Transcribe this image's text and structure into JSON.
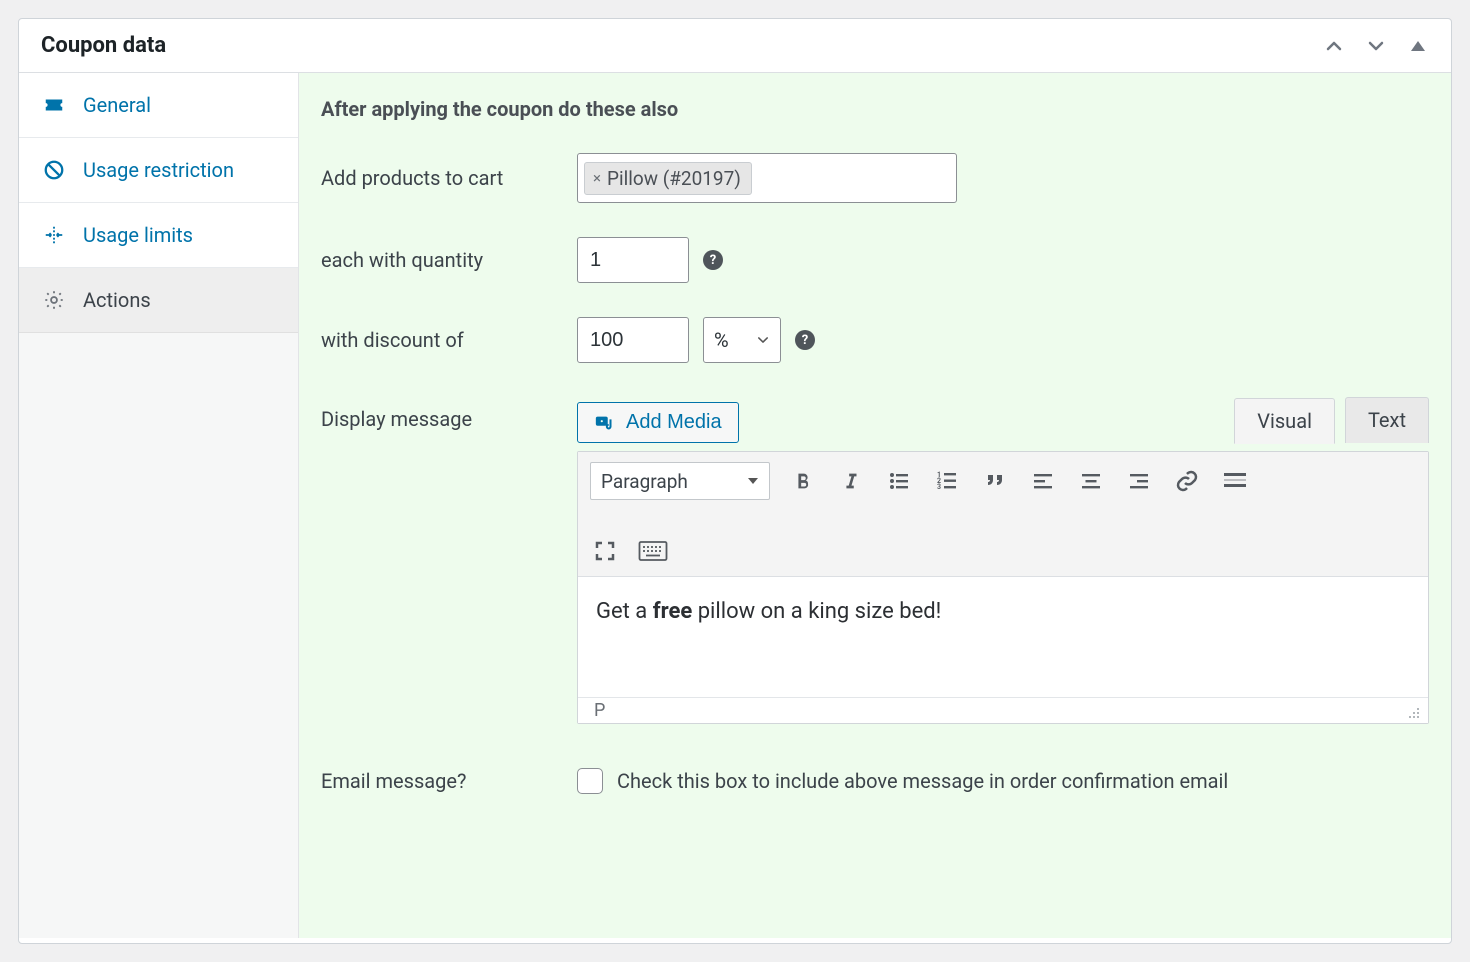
{
  "panel": {
    "title": "Coupon data"
  },
  "sidebar": {
    "items": [
      {
        "id": "general",
        "label": "General"
      },
      {
        "id": "usage-restriction",
        "label": "Usage restriction"
      },
      {
        "id": "usage-limits",
        "label": "Usage limits"
      },
      {
        "id": "actions",
        "label": "Actions"
      }
    ],
    "active": "actions"
  },
  "content": {
    "heading": "After applying the coupon do these also",
    "add_products_label": "Add products to cart",
    "products": [
      {
        "label": "Pillow (#20197)"
      }
    ],
    "quantity_label": "each with quantity",
    "quantity_value": "1",
    "discount_label": "with discount of",
    "discount_value": "100",
    "discount_unit": "%",
    "display_message_label": "Display message",
    "add_media_label": "Add Media",
    "tabs": {
      "visual": "Visual",
      "text": "Text",
      "active": "visual"
    },
    "format_select": "Paragraph",
    "message_before": "Get a ",
    "message_bold": "free",
    "message_after": " pillow on a king size bed!",
    "statusbar_path": "P",
    "email_label": "Email message?",
    "email_checkbox_text": "Check this box to include above message in order confirmation email",
    "email_checked": false
  }
}
